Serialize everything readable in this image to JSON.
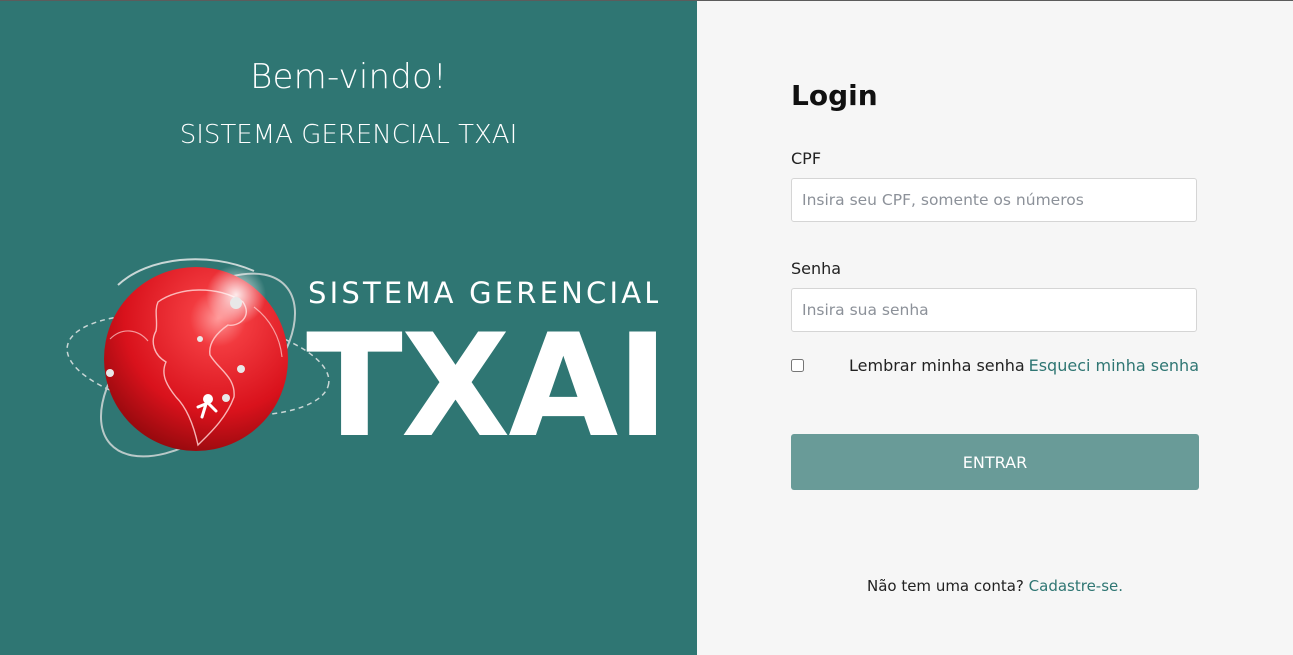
{
  "hero": {
    "welcome": "Bem-vindo!",
    "system_name": "SISTEMA GERENCIAL TXAI",
    "logo": {
      "top_text": "SISTEMA GERENCIAL",
      "main_text": "TXAI",
      "icon": "globe-icon"
    }
  },
  "login": {
    "title": "Login",
    "cpf": {
      "label": "CPF",
      "placeholder": "Insira seu CPF, somente os números",
      "value": ""
    },
    "password": {
      "label": "Senha",
      "placeholder": "Insira sua senha",
      "value": ""
    },
    "remember_label": "Lembrar minha senha",
    "forgot_label": "Esqueci minha senha",
    "submit_label": "ENTRAR",
    "signup_prompt": "Não tem uma conta?",
    "signup_link": "Cadastre-se."
  },
  "colors": {
    "brand_teal": "#2f7673",
    "button": "#699b98",
    "globe_red": "#e01b24"
  }
}
